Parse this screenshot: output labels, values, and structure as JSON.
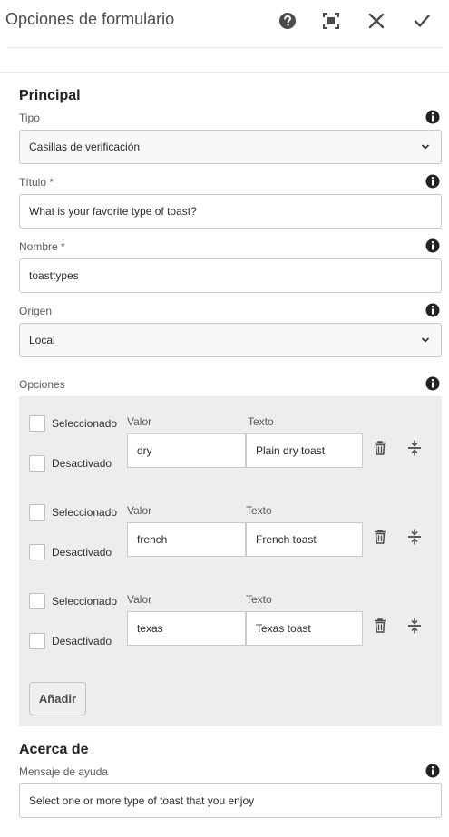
{
  "header": {
    "title": "Opciones de formulario",
    "icons": [
      "help-icon",
      "fullscreen-icon",
      "close-icon",
      "check-icon"
    ]
  },
  "principal": {
    "section_title": "Principal",
    "tipo": {
      "label": "Tipo",
      "value": "Casillas de verificación"
    },
    "titulo": {
      "label": "Título *",
      "value": "What is your favorite type of toast?"
    },
    "nombre": {
      "label": "Nombre *",
      "value": "toasttypes"
    },
    "origen": {
      "label": "Origen",
      "value": "Local"
    },
    "opciones": {
      "label": "Opciones",
      "rows": [
        {
          "seleccionado": "Seleccionado",
          "desactivado": "Desactivado",
          "valor_label": "Valor",
          "texto_label": "Texto",
          "valor": "dry",
          "texto": "Plain dry toast"
        },
        {
          "seleccionado": "Seleccionado",
          "desactivado": "Desactivado",
          "valor_label": "Valor",
          "texto_label": "Texto",
          "valor": "french",
          "texto": "French toast"
        },
        {
          "seleccionado": "Seleccionado",
          "desactivado": "Desactivado",
          "valor_label": "Valor",
          "texto_label": "Texto",
          "valor": "texas",
          "texto": "Texas toast"
        }
      ],
      "add_label": "Añadir"
    }
  },
  "acerca": {
    "section_title": "Acerca de",
    "mensaje": {
      "label": "Mensaje de ayuda",
      "value": "Select one or more type of toast that you enjoy"
    }
  },
  "colors": {
    "panel_bg": "#ededed",
    "icon": "#4b4b4b",
    "border": "#cacaca"
  }
}
